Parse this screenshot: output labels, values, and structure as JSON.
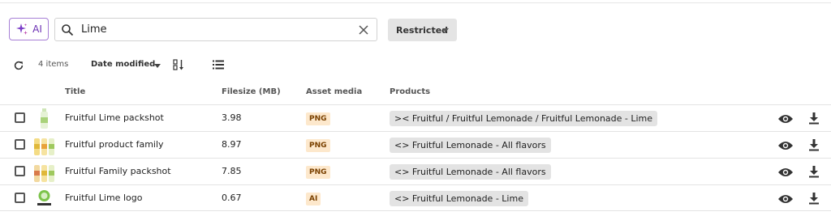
{
  "toolbar": {
    "ai_label": "AI",
    "search_value": "Lime",
    "restriction_label": "Restricted"
  },
  "list_controls": {
    "item_count": "4 items",
    "sort_label": "Date modified"
  },
  "columns": {
    "title": "Title",
    "filesize": "Filesize (MB)",
    "asset_media": "Asset media",
    "products": "Products"
  },
  "rows": [
    {
      "title": "Fruitful Lime packshot",
      "filesize": "3.98",
      "media": "PNG",
      "product": ">< Fruitful / Fruitful Lemonade / Fruitful Lemonade - Lime"
    },
    {
      "title": "Fruitful product family",
      "filesize": "8.97",
      "media": "PNG",
      "product": "<> Fruitful Lemonade - All flavors"
    },
    {
      "title": "Fruitful Family packshot",
      "filesize": "7.85",
      "media": "PNG",
      "product": "<> Fruitful Lemonade - All flavors"
    },
    {
      "title": "Fruitful Lime logo",
      "filesize": "0.67",
      "media": "AI",
      "product": "<> Fruitful Lemonade - Lime"
    }
  ],
  "colors": {
    "ai_accent": "#6b2fb3",
    "badge_bg": "#fde8cc",
    "chip_bg": "#e3e3e3"
  }
}
